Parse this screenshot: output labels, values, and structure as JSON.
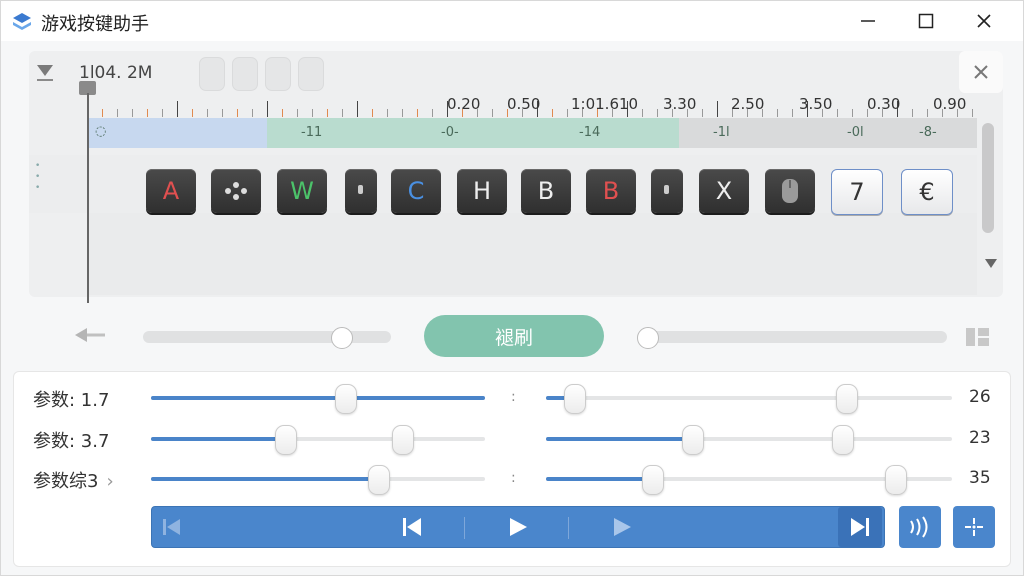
{
  "window": {
    "title": "游戏按键助手"
  },
  "icons": {
    "app": "app-logo-icon",
    "minimize": "minimize-icon",
    "maximize": "maximize-icon",
    "close": "close-icon",
    "collapse": "collapse-triangle-icon",
    "panel_close": "close-icon",
    "back": "back-arrow-icon",
    "layout": "layout-grid-icon",
    "scroll_down": "triangle-down-icon"
  },
  "timeline": {
    "time": "1l04. 2M",
    "ruler_labels": [
      "0.20",
      "0.50",
      "1:01.610",
      "3.30",
      "2.50",
      "3.50",
      "0.30",
      "0.90"
    ],
    "lane_labels": [
      "-11",
      "-0-",
      "-14",
      "-1l",
      "-0l",
      "-8-"
    ],
    "keys": [
      {
        "label": "A",
        "color": "#e05050",
        "style": "dark"
      },
      {
        "label": "",
        "color": "#dddddd",
        "style": "dark",
        "icon": "gamepad-icon"
      },
      {
        "label": "W",
        "color": "#4cc36a",
        "style": "dark"
      },
      {
        "label": "",
        "color": "#cccccc",
        "style": "dark-narrow",
        "icon": "small-key-icon"
      },
      {
        "label": "C",
        "color": "#4a90e2",
        "style": "dark"
      },
      {
        "label": "H",
        "color": "#eeeeee",
        "style": "dark"
      },
      {
        "label": "B",
        "color": "#eeeeee",
        "style": "dark"
      },
      {
        "label": "B",
        "color": "#e05050",
        "style": "dark"
      },
      {
        "label": "",
        "color": "#cccccc",
        "style": "dark-narrow",
        "icon": "small-key-icon"
      },
      {
        "label": "X",
        "color": "#eeeeee",
        "style": "dark"
      },
      {
        "label": "",
        "color": "#cccccc",
        "style": "dark",
        "icon": "mouse-icon"
      },
      {
        "label": "7",
        "color": "#333333",
        "style": "light"
      },
      {
        "label": "€",
        "color": "#333333",
        "style": "light"
      }
    ]
  },
  "controls": {
    "action_label": "褪刷",
    "accent": "#82c4ae"
  },
  "params": [
    {
      "label": "参数: ",
      "value_text": "1.7",
      "left_fill": 1.0,
      "left_knob": 0.58,
      "left_knob2": null,
      "right_fill": 0.07,
      "right_knob": 0.07,
      "right_knob2": 0.74,
      "end_value": "26",
      "sep": ":"
    },
    {
      "label": "参数: ",
      "value_text": "3.7",
      "left_fill": 0.4,
      "left_knob": 0.4,
      "left_knob2": 0.75,
      "right_fill": 0.36,
      "right_knob": 0.36,
      "right_knob2": 0.73,
      "end_value": "23",
      "sep": ""
    },
    {
      "label": "参数综3",
      "value_text": "",
      "left_fill": 0.68,
      "left_knob": 0.68,
      "left_knob2": null,
      "right_fill": 0.26,
      "right_knob": 0.26,
      "right_knob2": 0.86,
      "end_value": "35",
      "sep": ":"
    }
  ],
  "transport": {
    "buttons": [
      "skip-start-faded-icon",
      "skip-start-icon",
      "play-icon",
      "play-faded-icon",
      "skip-end-icon"
    ],
    "extra": [
      "wave-icon",
      "crosshair-icon"
    ],
    "color": "#4a86cc"
  }
}
